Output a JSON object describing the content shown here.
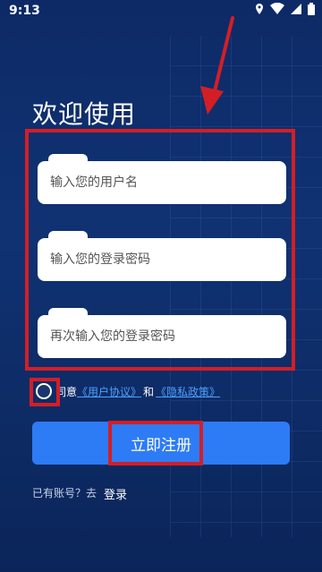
{
  "status_bar": {
    "time": "9:13"
  },
  "page": {
    "title": "欢迎使用"
  },
  "form": {
    "username_placeholder": "输入您的用户名",
    "password_placeholder": "输入您的登录密码",
    "confirm_placeholder": "再次输入您的登录密码"
  },
  "agreement": {
    "prefix": "同意",
    "user_agreement": "《用户协议》",
    "and": "和",
    "privacy_policy": "《隐私政策》"
  },
  "register_button": "立即注册",
  "footer": {
    "has_account": "已有账号？去",
    "login": "登录"
  },
  "colors": {
    "background": "#0d2a66",
    "primary_button": "#2e7bf6",
    "link": "#4da2ff",
    "highlight_box": "#d41e26"
  }
}
